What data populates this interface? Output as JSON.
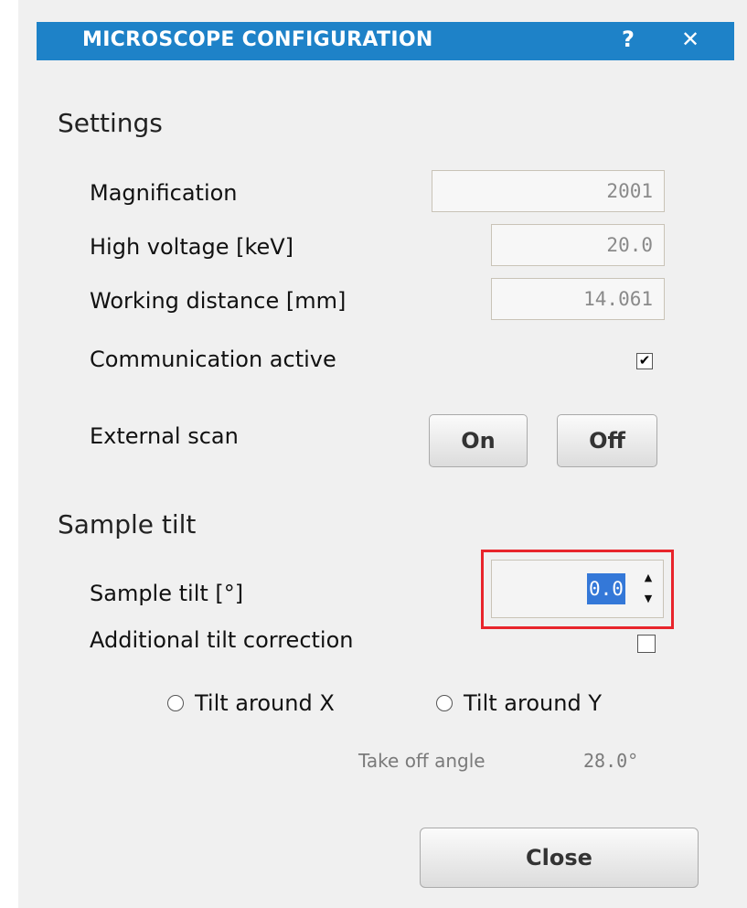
{
  "window": {
    "title": "MICROSCOPE CONFIGURATION",
    "help_label": "?",
    "close_label": "✕"
  },
  "settings": {
    "heading": "Settings",
    "magnification": {
      "label": "Magnification",
      "value": "2001"
    },
    "high_voltage": {
      "label": "High voltage [keV]",
      "value": "20.0"
    },
    "working_distance": {
      "label": "Working distance [mm]",
      "value": "14.061"
    },
    "communication_active": {
      "label": "Communication active",
      "checked": true,
      "mark": "✔"
    },
    "external_scan": {
      "label": "External scan",
      "on_label": "On",
      "off_label": "Off"
    }
  },
  "sample_tilt": {
    "heading": "Sample tilt",
    "tilt": {
      "label": "Sample tilt [°]",
      "value": "0.0",
      "up": "▲",
      "down": "▼"
    },
    "additional_correction": {
      "label": "Additional tilt correction",
      "checked": false
    },
    "tilt_x_label": "Tilt around X",
    "tilt_y_label": "Tilt around Y",
    "take_off_label": "Take off angle",
    "take_off_value": "28.0°"
  },
  "footer": {
    "close_label": "Close"
  },
  "colors": {
    "titlebar": "#1e82c8",
    "highlight": "#e8242b",
    "selection": "#3478d8"
  }
}
